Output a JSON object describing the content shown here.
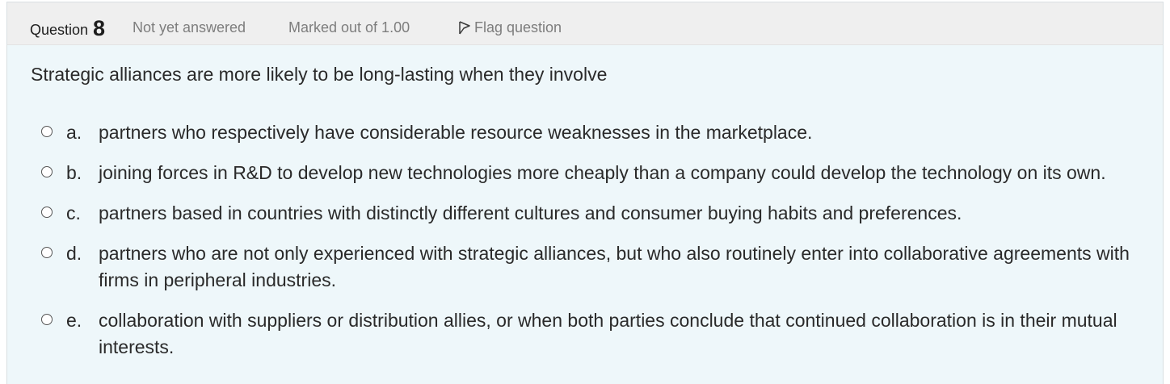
{
  "header": {
    "question_label": "Question",
    "question_number": "8",
    "status": "Not yet answered",
    "marks": "Marked out of 1.00",
    "flag_label": "Flag question"
  },
  "question": {
    "text": "Strategic alliances are more likely to be long-lasting when they involve"
  },
  "options": [
    {
      "letter": "a.",
      "text": "partners who respectively have considerable resource weaknesses in the marketplace."
    },
    {
      "letter": "b.",
      "text": "joining forces in R&D to develop new technologies more cheaply than a company could develop the technology on its own."
    },
    {
      "letter": "c.",
      "text": "partners based in countries with distinctly different cultures and consumer buying habits and preferences."
    },
    {
      "letter": "d.",
      "text": "partners who are not only experienced with strategic alliances, but who also routinely enter into collaborative agreements with firms in peripheral industries."
    },
    {
      "letter": "e.",
      "text": "collaboration with suppliers or distribution allies, or when both parties conclude that continued collaboration is in their mutual interests."
    }
  ],
  "colors": {
    "card_background": "#eef7fa",
    "header_background": "#efefef",
    "text": "#2a2a2a",
    "muted_text": "#7d7d7d"
  },
  "icons": {
    "flag": "flag-icon",
    "radio": "radio-unchecked-icon"
  }
}
